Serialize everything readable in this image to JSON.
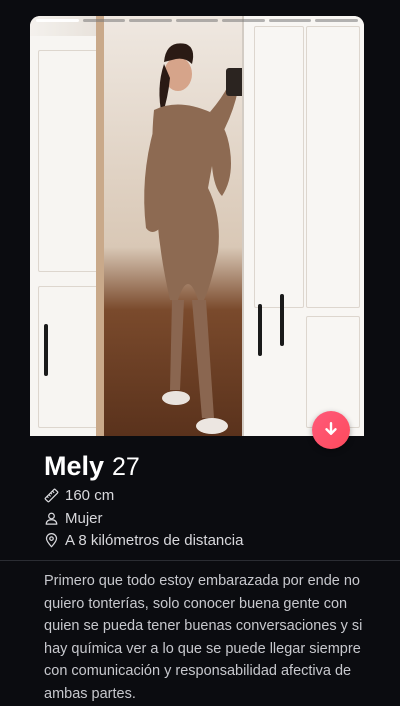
{
  "profile": {
    "name": "Mely",
    "age": "27",
    "height": "160 cm",
    "gender": "Mujer",
    "distance": "A 8 kilómetros de distancia",
    "bio": "Primero que todo estoy embarazada por ende no quiero tonterías, solo conocer buena gente con quien se pueda tener buenas conversaciones y si hay química ver a lo que se puede llegar siempre con comunicación y responsabilidad afectiva de ambas partes."
  },
  "photo_progress": {
    "total": 7,
    "active_index": 0
  },
  "icons": {
    "height": "ruler-icon",
    "gender": "person-icon",
    "distance": "location-pin-icon",
    "expand": "arrow-down-icon"
  },
  "colors": {
    "background": "#0b0c10",
    "accent": "#fd4a5c",
    "text_primary": "#ffffff",
    "text_secondary": "#c7c8cd"
  }
}
